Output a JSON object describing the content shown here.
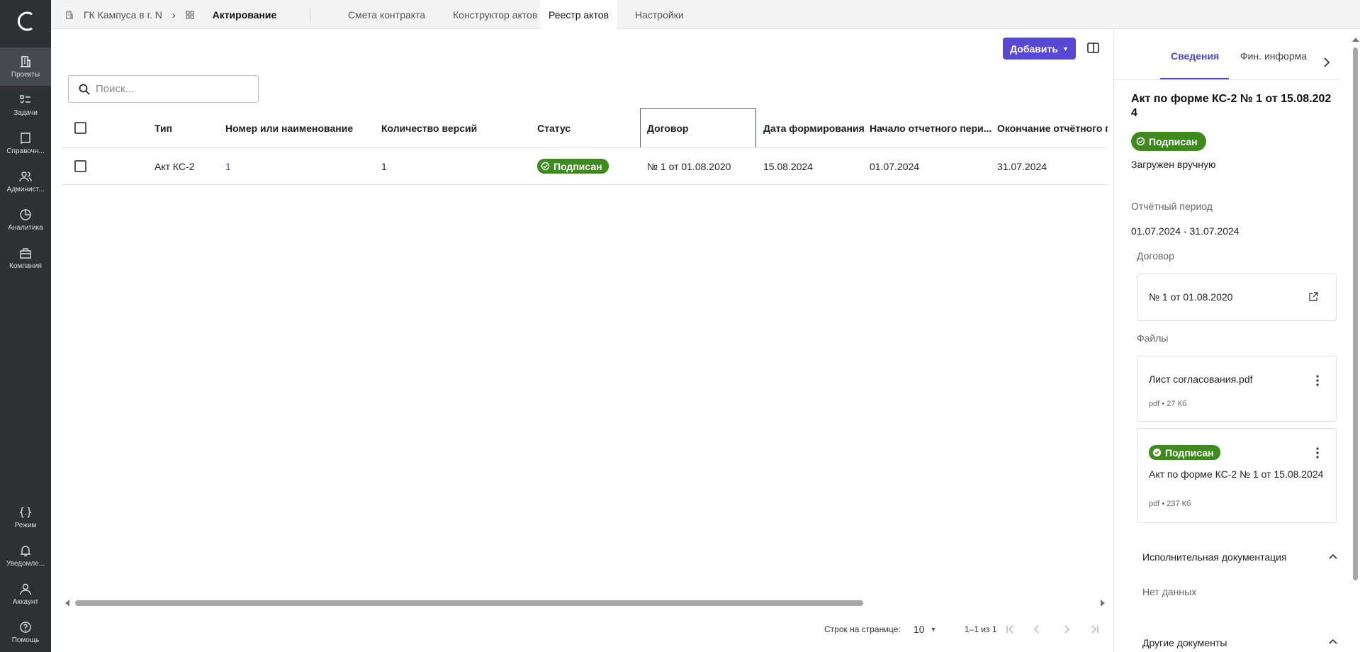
{
  "rail": {
    "items": [
      {
        "label": "Проекты",
        "icon": "building-icon",
        "active": true
      },
      {
        "label": "Задачи",
        "icon": "tasks-icon"
      },
      {
        "label": "Справочн...",
        "icon": "book-icon"
      },
      {
        "label": "Админист...",
        "icon": "users-icon"
      },
      {
        "label": "Аналитика",
        "icon": "pie-chart-icon"
      },
      {
        "label": "Компания",
        "icon": "briefcase-icon"
      }
    ],
    "bottom": [
      {
        "label": "Режим",
        "icon": "code-braces-icon"
      },
      {
        "label": "Уведомле...",
        "icon": "bell-icon"
      },
      {
        "label": "Аккаунт",
        "icon": "person-icon"
      },
      {
        "label": "Помощь",
        "icon": "help-icon"
      }
    ]
  },
  "breadcrumb": {
    "project": "ГК Кампуса в г. N",
    "separator": "›",
    "current": "Актирование"
  },
  "tabs": [
    {
      "label": "Смета контракта"
    },
    {
      "label": "Конструктор актов"
    },
    {
      "label": "Реестр актов",
      "active": true
    },
    {
      "label": "Настройки"
    }
  ],
  "toolbar": {
    "add_label": "Добавить"
  },
  "search": {
    "placeholder": "Поиск..."
  },
  "table": {
    "headers": {
      "type": "Тип",
      "number": "Номер или наименование",
      "versions": "Количество версий",
      "status": "Статус",
      "contract": "Договор",
      "date": "Дата формирования",
      "period_start": "Начало отчетного пери...",
      "period_end": "Окончание отчётного п"
    },
    "rows": [
      {
        "type": "Акт КС-2",
        "number": "1",
        "versions": "1",
        "status": "Подписан",
        "contract": "№ 1 от 01.08.2020",
        "date": "15.08.2024",
        "period_start": "01.07.2024",
        "period_end": "31.07.2024"
      }
    ]
  },
  "pagination": {
    "rows_label": "Строк на странице:",
    "rows_value": "10",
    "range": "1–1 из 1"
  },
  "panel": {
    "tabs": [
      {
        "label": "Сведения",
        "active": true
      },
      {
        "label": "Фин. информа"
      }
    ],
    "title": "Акт по форме КС-2 № 1 от 15.08.2024",
    "status": "Подписан",
    "upload_note": "Загружен вручную",
    "period_label": "Отчётный период",
    "period_value": "01.07.2024 - 31.07.2024",
    "contract_label": "Договор",
    "contract_value": "№ 1 от 01.08.2020",
    "files_label": "Файлы",
    "files": [
      {
        "name": "Лист согласования.pdf",
        "meta": "pdf • 27 Кб"
      },
      {
        "badge": "Подписан",
        "name": "Акт по форме КС-2 № 1 от 15.08.2024",
        "meta": "pdf • 237 Кб"
      }
    ],
    "exec_docs_label": "Исполнительная документация",
    "exec_docs_empty": "Нет данных",
    "other_docs_label": "Другие документы"
  },
  "colors": {
    "accent": "#5848d6",
    "link": "#4b46d6",
    "success": "#3e8a1e",
    "rail": "#2e3033"
  }
}
